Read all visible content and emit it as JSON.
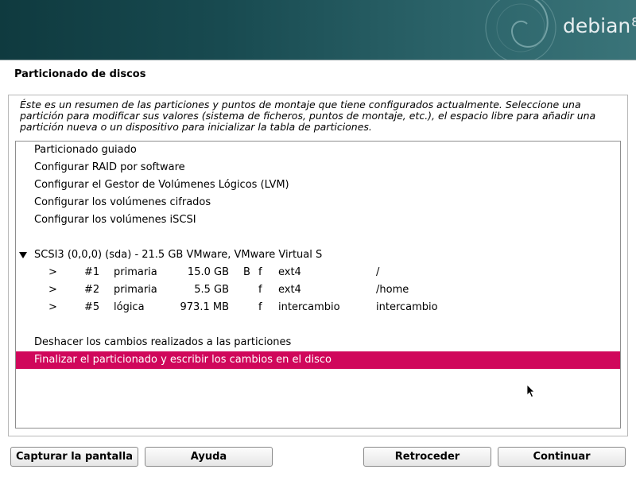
{
  "banner": {
    "logo_text": "debian",
    "logo_version": "8"
  },
  "page_title": "Particionado de discos",
  "intro_text": "Éste es un resumen de las particiones y puntos de montaje que tiene configurados actualmente. Seleccione una partición para modificar sus valores (sistema de ficheros, puntos de montaje, etc.), el espacio libre para añadir una partición nueva o un dispositivo para inicializar la tabla de particiones.",
  "menu": {
    "items": [
      "Particionado guiado",
      "Configurar RAID por software",
      "Configurar el Gestor de Volúmenes Lógicos (LVM)",
      "Configurar los volúmenes cifrados",
      "Configurar los volúmenes iSCSI"
    ]
  },
  "disk": {
    "label": "SCSI3 (0,0,0) (sda) - 21.5 GB VMware, VMware Virtual S",
    "partitions": [
      {
        "arrow": ">",
        "num": "#1",
        "type": "primaria",
        "size": "15.0 GB",
        "boot": "B",
        "format": "f",
        "fs": "ext4",
        "mount": "/"
      },
      {
        "arrow": ">",
        "num": "#2",
        "type": "primaria",
        "size": "5.5 GB",
        "boot": "",
        "format": "f",
        "fs": "ext4",
        "mount": "/home"
      },
      {
        "arrow": ">",
        "num": "#5",
        "type": "lógica",
        "size": "973.1 MB",
        "boot": "",
        "format": "f",
        "fs": "intercambio",
        "mount": "intercambio"
      }
    ]
  },
  "actions": {
    "undo": "Deshacer los cambios realizados a las particiones",
    "finish": "Finalizar el particionado y escribir los cambios en el disco"
  },
  "buttons": {
    "capture": "Capturar la pantalla",
    "help": "Ayuda",
    "back": "Retroceder",
    "continue": "Continuar"
  },
  "colors": {
    "selection": "#d0075b",
    "banner": "#184a50"
  }
}
